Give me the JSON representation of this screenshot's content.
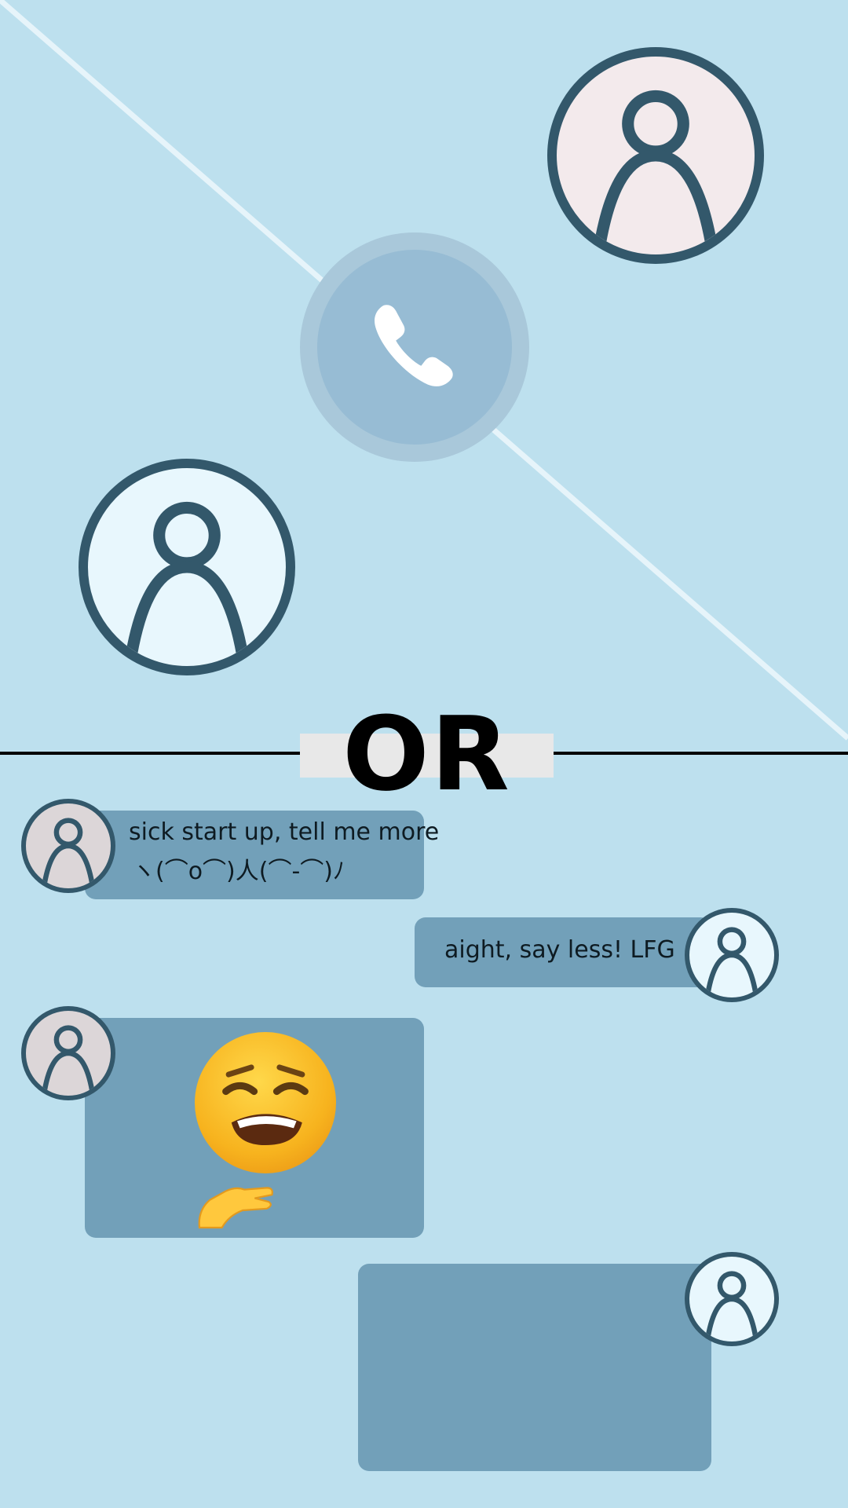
{
  "colors": {
    "background": "#bde0ee",
    "bubble": "#72a0b9",
    "avatar_ring": "#33586b",
    "avatar_fill_caller": "#f3eaec",
    "avatar_fill_self": "#e8f7fd",
    "avatar_fill_friend": "#dcd6d8",
    "call_button": "#97bcd4",
    "divider": "#000000"
  },
  "call": {
    "icon": "phone-icon"
  },
  "divider": {
    "label": "OR"
  },
  "chat": {
    "messages": [
      {
        "from": "friend",
        "line1": "sick start up, tell me more",
        "line2": "ヽ(⌒o⌒)人(⌒-⌒)ﾉ"
      },
      {
        "from": "self",
        "text": "aight, say less! LFG"
      },
      {
        "from": "friend",
        "emoji": "😩",
        "emoji_name": "weary-face-icon",
        "hand": "🤌"
      },
      {
        "from": "self",
        "text": ""
      }
    ]
  }
}
